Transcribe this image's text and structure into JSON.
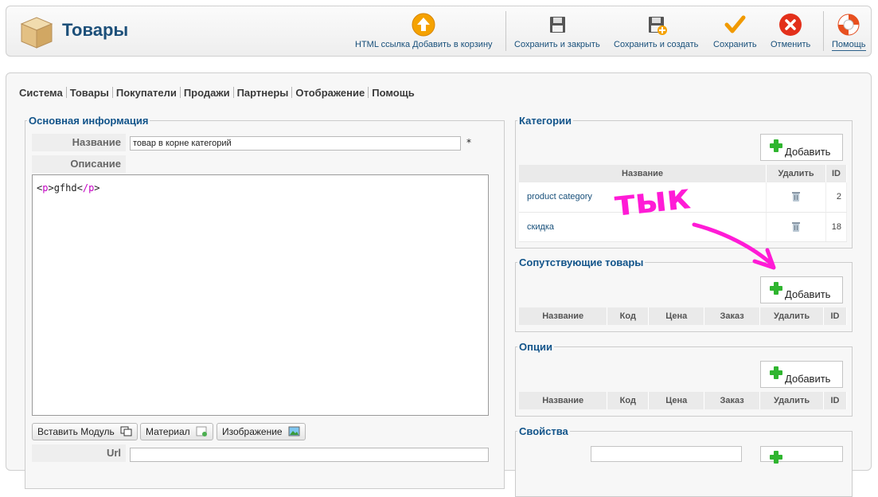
{
  "header": {
    "title": "Товары",
    "buttons": [
      {
        "label": "HTML ссылка Добавить в корзину",
        "icon": "arrow-up-circle-icon"
      },
      {
        "label": "Сохранить и закрыть",
        "icon": "floppy-disk-icon"
      },
      {
        "label": "Сохранить и создать",
        "icon": "floppy-disk-plus-icon"
      },
      {
        "label": "Сохранить",
        "icon": "check-icon"
      },
      {
        "label": "Отменить",
        "icon": "cancel-circle-icon"
      },
      {
        "label": "Помощь",
        "icon": "lifebuoy-icon"
      }
    ]
  },
  "nav": [
    "Система",
    "Товары",
    "Покупатели",
    "Продажи",
    "Партнеры",
    "Отображение",
    "Помощь"
  ],
  "main_info": {
    "legend": "Основная информация",
    "name_label": "Название",
    "name_value": "товар в корне категорий",
    "required_mark": "*",
    "desc_label": "Описание",
    "editor": {
      "open_tag": "p",
      "text": "gfhd",
      "close_tag": "/p"
    },
    "buttons": {
      "insert_module": "Вставить Модуль",
      "material": "Материал",
      "image": "Изображение"
    },
    "url_label": "Url"
  },
  "categories": {
    "legend": "Категории",
    "add_label": "Добавить",
    "columns": [
      "Название",
      "Удалить",
      "ID"
    ],
    "rows": [
      {
        "name": "product category",
        "id": "2"
      },
      {
        "name": "скидка",
        "id": "18"
      }
    ]
  },
  "related": {
    "legend": "Сопутствующие товары",
    "add_label": "Добавить",
    "columns": [
      "Название",
      "Код",
      "Цена",
      "Заказ",
      "Удалить",
      "ID"
    ]
  },
  "options": {
    "legend": "Опции",
    "add_label": "Добавить",
    "columns": [
      "Название",
      "Код",
      "Цена",
      "Заказ",
      "Удалить",
      "ID"
    ]
  },
  "properties": {
    "legend": "Свойства"
  },
  "annotation": {
    "text": "тык",
    "color": "#ff1bd6"
  },
  "colors": {
    "link": "#174f7a",
    "legend": "#12548a",
    "accent_pink": "#ff1bd6"
  }
}
